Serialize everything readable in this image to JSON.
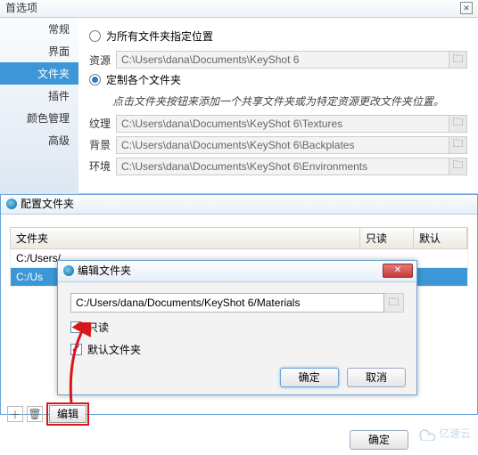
{
  "prefs": {
    "title": "首选项",
    "sidebar": [
      "常规",
      "界面",
      "文件夹",
      "插件",
      "颜色管理",
      "高级"
    ],
    "active_index": 2,
    "opt_all": "为所有文件夹指定位置",
    "opt_custom": "定制各个文件夹",
    "help": "点击文件夹按钮来添加一个共享文件夹或为特定资源更改文件夹位置。",
    "rows": [
      {
        "label": "资源",
        "path": "C:\\Users\\dana\\Documents\\KeyShot 6"
      },
      {
        "label": "纹理",
        "path": "C:\\Users\\dana\\Documents\\KeyShot 6\\Textures"
      },
      {
        "label": "背景",
        "path": "C:\\Users\\dana\\Documents\\KeyShot 6\\Backplates"
      },
      {
        "label": "环境",
        "path": "C:\\Users\\dana\\Documents\\KeyShot 6\\Environments"
      }
    ]
  },
  "config": {
    "title": "配置文件夹",
    "cols": [
      "文件夹",
      "只读",
      "默认"
    ],
    "rows": [
      {
        "path": "C:/Users/...",
        "sel": false
      },
      {
        "path": "C:/Us",
        "sel": true
      }
    ]
  },
  "edit": {
    "title": "编辑文件夹",
    "path": "C:/Users/dana/Documents/KeyShot 6/Materials",
    "readonly_label": "只读",
    "default_label": "默认文件夹",
    "ok": "确定",
    "cancel": "取消"
  },
  "toolbar": {
    "edit": "编辑"
  },
  "footer": {
    "ok": "确定"
  },
  "watermark": "亿速云"
}
